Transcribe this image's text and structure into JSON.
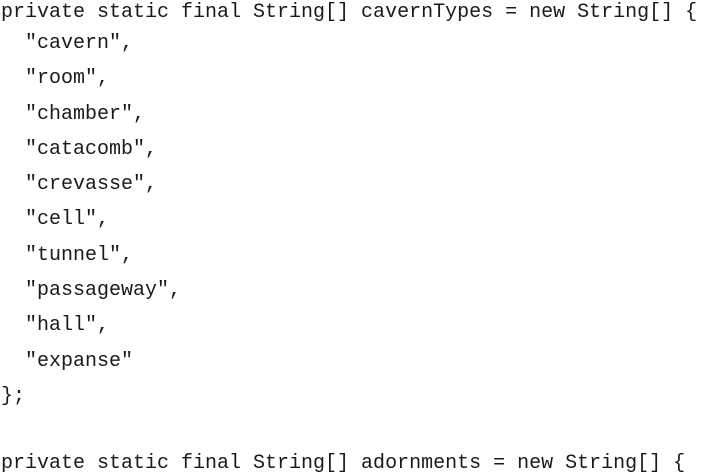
{
  "code": {
    "lines": [
      "private static final String[] cavernTypes = new String[] {",
      "\"cavern\",",
      "\"room\",",
      "\"chamber\",",
      "\"catacomb\",",
      "\"crevasse\",",
      "\"cell\",",
      "\"tunnel\",",
      "\"passageway\",",
      "\"hall\",",
      "\"expanse\"",
      "};",
      "private static final String[] adornments = new String[] {"
    ]
  }
}
